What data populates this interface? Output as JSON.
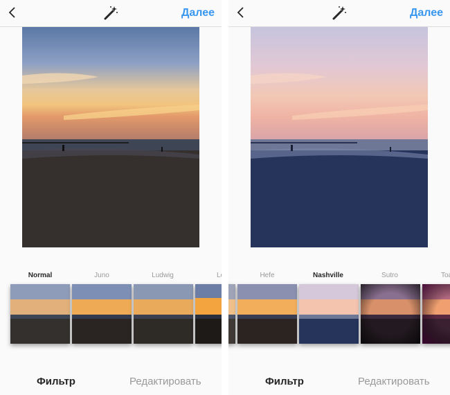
{
  "colors": {
    "accent": "#3897f0",
    "text_active": "#262626",
    "text_inactive": "#999999"
  },
  "panels": [
    {
      "header": {
        "next_label": "Далее"
      },
      "photo_filter": "normal",
      "filters": [
        {
          "label": "Normal",
          "active": true,
          "style": "normal"
        },
        {
          "label": "Juno",
          "active": false,
          "style": "juno"
        },
        {
          "label": "Ludwig",
          "active": false,
          "style": "ludwig"
        },
        {
          "label": "Lo",
          "active": false,
          "style": "lofi"
        }
      ],
      "tabs": {
        "filter": "Фильтр",
        "edit": "Редактировать"
      }
    },
    {
      "header": {
        "next_label": "Далее"
      },
      "photo_filter": "nashville",
      "filters": [
        {
          "label": "Hefe",
          "active": false,
          "style": "hefe"
        },
        {
          "label": "Nashville",
          "active": true,
          "style": "nashville"
        },
        {
          "label": "Sutro",
          "active": false,
          "style": "sutro"
        },
        {
          "label": "Toa",
          "active": false,
          "style": "toaster"
        }
      ],
      "tabs": {
        "filter": "Фильтр",
        "edit": "Редактировать"
      }
    }
  ]
}
